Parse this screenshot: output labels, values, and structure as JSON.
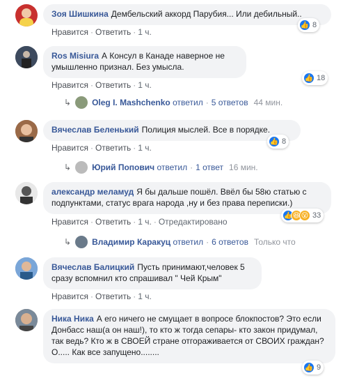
{
  "actions": {
    "like": "Нравится",
    "reply": "Ответить",
    "edited": "Отредактировано",
    "sep": "·"
  },
  "comments": [
    {
      "author": "Зоя Шишкина",
      "text": "Дембельский аккорд Парубия... Или дебильный..",
      "time": "1 ч.",
      "reactions": "8"
    },
    {
      "author": "Ros Misiura",
      "text": "А Консул в Канаде наверное не умышленно признал. Без умысла.",
      "time": "1 ч.",
      "reactions": "18",
      "reply": {
        "name": "Oleg I. Mashchenko",
        "replied": "ответил",
        "count": "5 ответов",
        "time": "44 мин."
      }
    },
    {
      "author": "Вячеслав Беленький",
      "text": "Полиция мыслей. Все в порядке.",
      "time": "1 ч.",
      "reactions": "8",
      "reply": {
        "name": "Юрий Попович",
        "replied": "ответил",
        "count": "1 ответ",
        "time": "16 мин."
      }
    },
    {
      "author": "александр меламуд",
      "text": "Я бы дальше пошёл. Ввёл бы 58ю статью с подпунктами, статус врага народа ,ну и без права переписки.)",
      "time": "1 ч.",
      "reactions": "33",
      "reply": {
        "name": "Владимир Каракуц",
        "replied": "ответил",
        "count": "6 ответов",
        "time": "Только что"
      }
    },
    {
      "author": "Вячеслав Балицкий",
      "text": "Пусть принимают,человек 5 сразу вспомнил кто спрашивал \" Чей Крым\"",
      "time": "1 ч."
    },
    {
      "author": "Ника Ника",
      "text": "А его ничего не смущает в вопросе блокпостов? Это если Донбасс наш(а он наш!), то кто ж тогда сепары- кто закон придумал, так ведь? Кто ж в СВОЕЙ стране отгораживается от СВОИХ граждан? О..... Как все запущено........",
      "time": "1 ч.",
      "reactions": "9"
    }
  ]
}
